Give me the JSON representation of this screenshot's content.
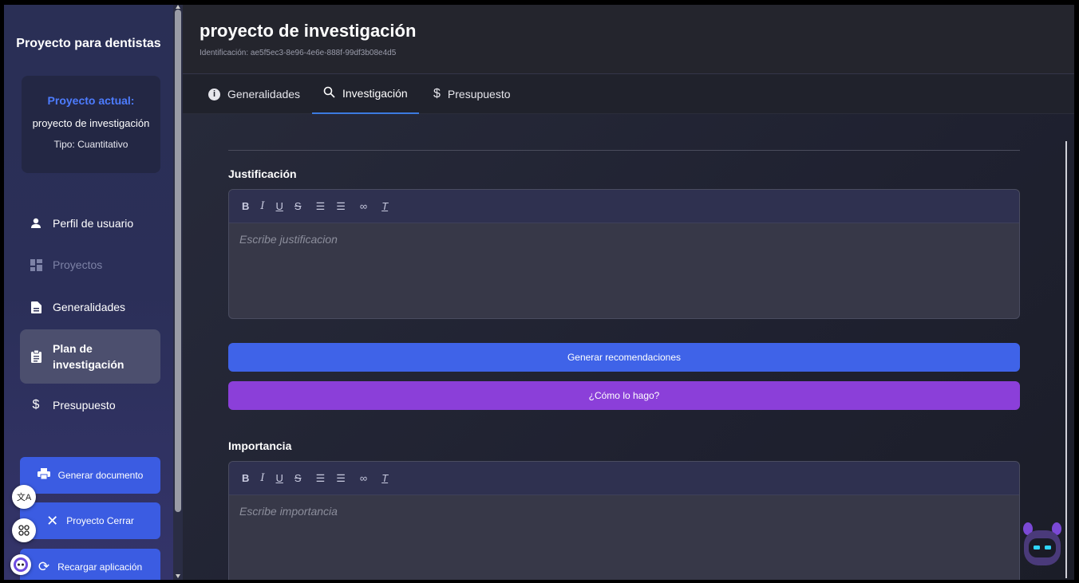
{
  "sidebar": {
    "app_title": "Proyecto para dentistas",
    "current_project": {
      "label": "Proyecto actual:",
      "name": "proyecto de investigación",
      "type": "Tipo: Cuantitativo"
    },
    "nav": [
      {
        "label": "Perfil de usuario",
        "icon": "user-icon",
        "disabled": false
      },
      {
        "label": "Proyectos",
        "icon": "dashboard-icon",
        "disabled": true
      },
      {
        "label": "Generalidades",
        "icon": "document-icon",
        "disabled": false
      },
      {
        "label": "Plan de investigación",
        "icon": "clipboard-icon",
        "active": true
      },
      {
        "label": "Presupuesto",
        "icon": "dollar-icon",
        "disabled": false
      }
    ],
    "buttons": {
      "generate_doc": "Generar documento",
      "close_project": "Proyecto Cerrar",
      "reload_app": "Recargar aplicación"
    }
  },
  "header": {
    "title": "proyecto de investigación",
    "identifier": "Identificación: ae5f5ec3-8e96-4e6e-888f-99df3b08e4d5"
  },
  "tabs": [
    {
      "label": "Generalidades",
      "icon": "info-icon"
    },
    {
      "label": "Investigación",
      "icon": "search-icon",
      "active": true
    },
    {
      "label": "Presupuesto",
      "icon": "dollar-icon"
    }
  ],
  "content": {
    "justificacion": {
      "label": "Justificación",
      "placeholder": "Escribe justificacion"
    },
    "buttons": {
      "recommendations": "Generar recomendaciones",
      "how_to": "¿Cómo lo hago?"
    },
    "importancia": {
      "label": "Importancia",
      "placeholder": "Escribe importancia"
    }
  },
  "colors": {
    "primary_blue": "#3f63e8",
    "purple": "#8b3fd9",
    "accent_label": "#4d7cff"
  }
}
